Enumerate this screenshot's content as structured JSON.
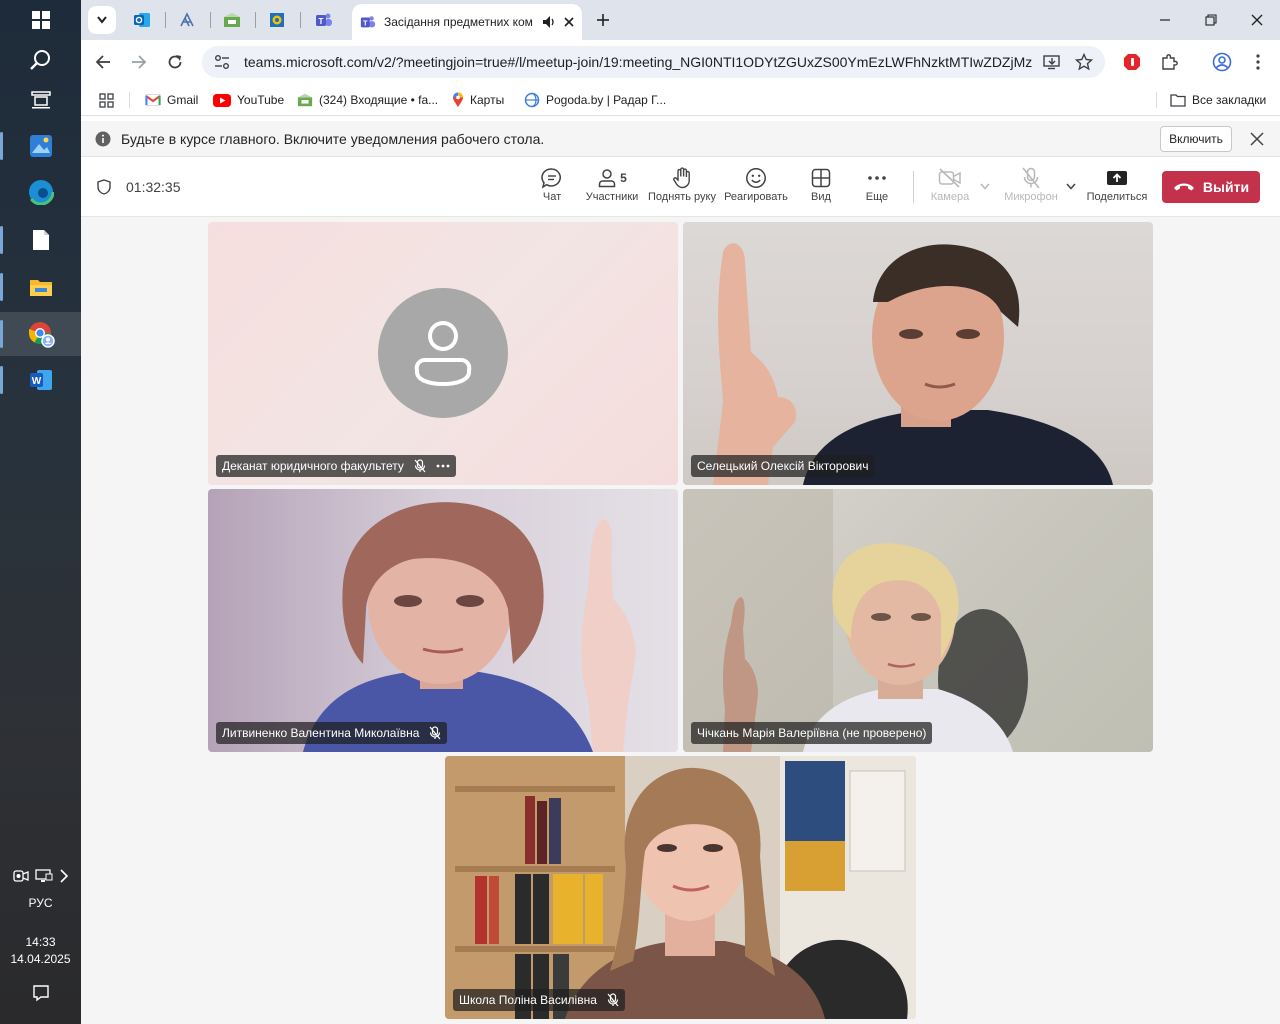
{
  "taskbar": {
    "language": "РУС",
    "time": "14:33",
    "date": "14.04.2025"
  },
  "tabs": {
    "active_title": "Засідання предметних ком"
  },
  "address": {
    "url": "teams.microsoft.com/v2/?meetingjoin=true#/l/meetup-join/19:meeting_NGI0NTI1ODYtZGUxZS00YmEzLWFhNzktMTIwZDZjMz..."
  },
  "bookmarks": {
    "items": [
      {
        "label": "Gmail"
      },
      {
        "label": "YouTube"
      },
      {
        "label": "(324) Входящие • fa..."
      },
      {
        "label": "Карты"
      },
      {
        "label": "Pogoda.by | Радар Г..."
      }
    ],
    "all_label": "Все закладки"
  },
  "banner": {
    "text": "Будьте в курсе главного. Включите уведомления рабочего стола.",
    "enable_label": "Включить"
  },
  "meeting": {
    "timer": "01:32:35",
    "participants_count": "5",
    "chat_label": "Чат",
    "participants_label": "Участники",
    "raise_hand_label": "Поднять руку",
    "react_label": "Реагировать",
    "view_label": "Вид",
    "more_label": "Еще",
    "camera_label": "Камера",
    "mic_label": "Микрофон",
    "share_label": "Поделиться",
    "leave_label": "Выйти"
  },
  "participants": [
    {
      "name": "Деканат юридичного факультету"
    },
    {
      "name": "Селецький Олексій Вікторович"
    },
    {
      "name": "Литвиненко Валентина Миколаївна"
    },
    {
      "name": "Чічкань Марія Валеріївна (не проверено)"
    },
    {
      "name": "Школа Поліна Василівна"
    }
  ],
  "colors": {
    "leave": "#c4314b",
    "teams_purple": "#5b5fc7",
    "tabstrip": "#dfe3eb"
  }
}
